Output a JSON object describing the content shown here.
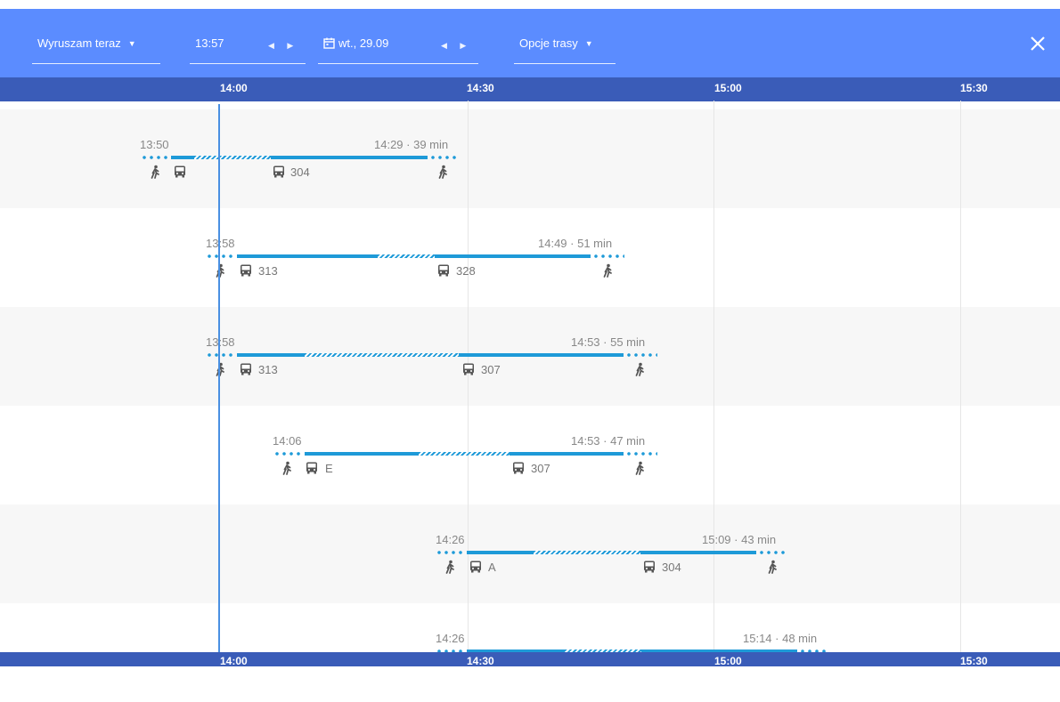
{
  "toolbar": {
    "depart_mode": "Wyruszam teraz",
    "time": "13:57",
    "date": "wt., 29.09",
    "route_options": "Opcje trasy",
    "close_icon": "close-icon",
    "calendar_icon": "calendar-icon"
  },
  "colors": {
    "toolbar": "#5b8cff",
    "axis": "#3a5cb8",
    "route": "#1e9ad8",
    "now_line": "#4a90e2"
  },
  "timeline": {
    "ticks": [
      "14:00",
      "14:30",
      "15:00",
      "15:30"
    ]
  },
  "routes": [
    {
      "start": "13:50",
      "end_summary": "14:29 · 39 min",
      "lines": [
        "304"
      ]
    },
    {
      "start": "13:58",
      "end_summary": "14:49 · 51 min",
      "lines": [
        "313",
        "328"
      ]
    },
    {
      "start": "13:58",
      "end_summary": "14:53 · 55 min",
      "lines": [
        "313",
        "307"
      ]
    },
    {
      "start": "14:06",
      "end_summary": "14:53 · 47 min",
      "lines": [
        "E",
        "307"
      ]
    },
    {
      "start": "14:26",
      "end_summary": "15:09 · 43 min",
      "lines": [
        "A",
        "304"
      ]
    },
    {
      "start": "14:26",
      "end_summary": "15:14 · 48 min",
      "lines": []
    }
  ]
}
